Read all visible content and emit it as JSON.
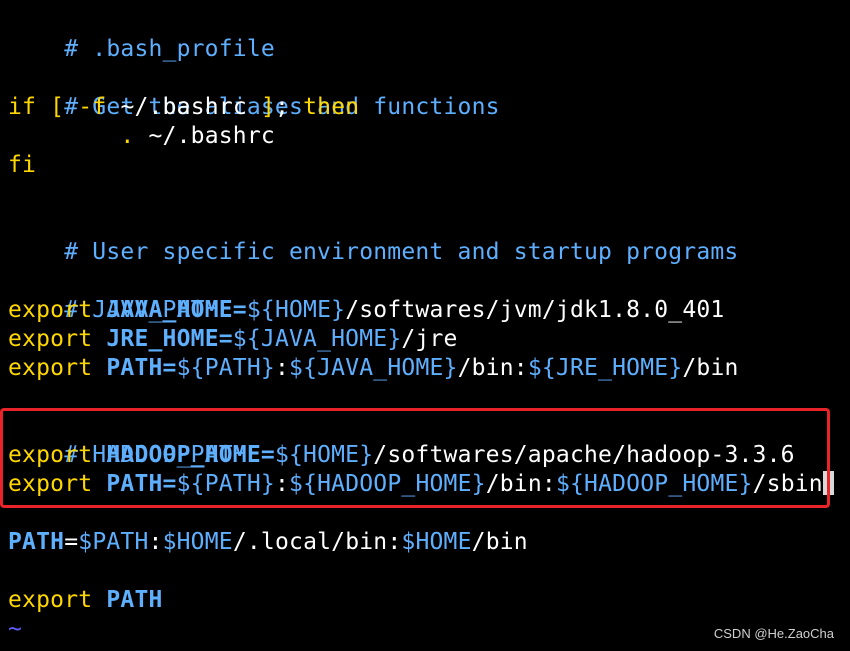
{
  "colors": {
    "background": "#000000",
    "comment": "#5fafff",
    "keyword": "#ffd700",
    "variable": "#5fafff",
    "text": "#ffffff",
    "tilde": "#5f5fff",
    "highlight_box": "#e8242a"
  },
  "lines": {
    "l1": {
      "comment": "# .bash_profile"
    },
    "l3": {
      "comment": "# Get the aliases and functions"
    },
    "l4": {
      "kw_if": "if",
      "bracket_open": "[",
      "flag": "-f",
      "path": " ~/.bashrc ",
      "bracket_close": "]",
      "semi": "; ",
      "kw_then": "then"
    },
    "l5": {
      "indent": "        ",
      "dot": ".",
      "path": " ~/.bashrc"
    },
    "l6": {
      "kw_fi": "fi"
    },
    "l8": {
      "comment": "# User specific environment and startup programs"
    },
    "l10": {
      "comment": "# JAVA_PATH"
    },
    "l11": {
      "kw": "export",
      "var": "JAVA_HOME=",
      "sub1": "${HOME}",
      "rest": "/softwares/jvm/jdk1.8.0_401"
    },
    "l12": {
      "kw": "export",
      "var": "JRE_HOME=",
      "sub1": "${JAVA_HOME}",
      "rest": "/jre"
    },
    "l13": {
      "kw": "export",
      "var": "PATH=",
      "sub1": "${PATH}",
      "sep1": ":",
      "sub2": "${JAVA_HOME}",
      "mid": "/bin:",
      "sub3": "${JRE_HOME}",
      "rest": "/bin"
    },
    "l15": {
      "comment": "# HADOOP_PATH"
    },
    "l16": {
      "kw": "export",
      "var": "HADOOP_HOME=",
      "sub1": "${HOME}",
      "rest": "/softwares/apache/hadoop-3.3.6"
    },
    "l17": {
      "kw": "export",
      "var": "PATH=",
      "sub1": "${PATH}",
      "sep1": ":",
      "sub2": "${HADOOP_HOME}",
      "mid": "/bin:",
      "sub3": "${HADOOP_HOME}",
      "rest": "/sbin"
    },
    "l19": {
      "var": "PATH",
      "eq": "=",
      "sub1": "$PATH",
      "sep1": ":",
      "sub2": "$HOME",
      "mid": "/.local/bin:",
      "sub3": "$HOME",
      "rest": "/bin"
    },
    "l21": {
      "kw": "export",
      "var": "PATH"
    },
    "l22": {
      "tilde": "~"
    }
  },
  "watermark": "CSDN @He.ZaoCha"
}
